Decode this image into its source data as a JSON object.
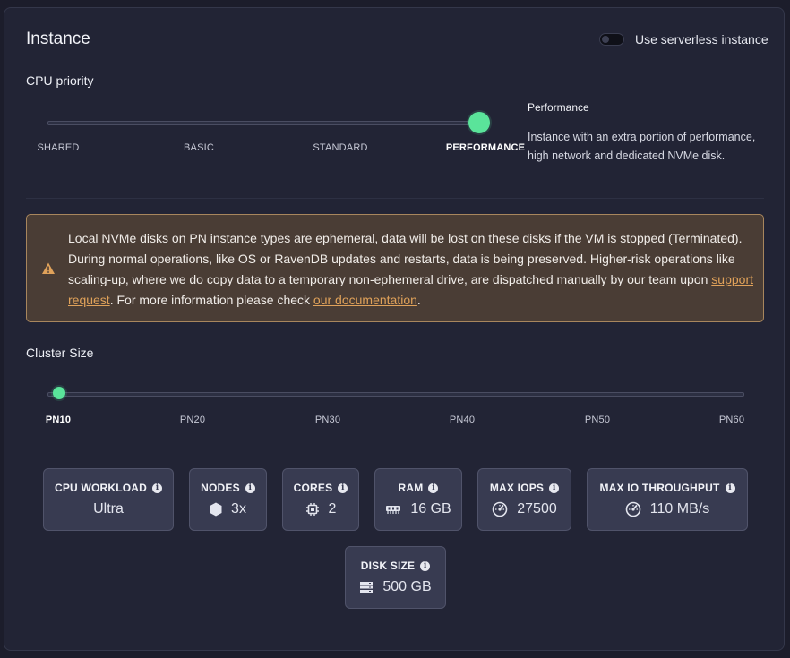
{
  "header": {
    "title": "Instance",
    "serverless_toggle": {
      "label": "Use serverless instance",
      "on": false
    }
  },
  "cpu_priority": {
    "label": "CPU priority",
    "options": [
      "SHARED",
      "BASIC",
      "STANDARD",
      "PERFORMANCE"
    ],
    "selected": "PERFORMANCE",
    "description_title": "Performance",
    "description": "Instance with an extra portion of performance, high network and dedicated NVMe disk."
  },
  "warning": {
    "text_1": "Local NVMe disks on PN instance types are ephemeral, data will be lost on these disks if the VM is stopped (Terminated). During normal operations, like OS or RavenDB updates and restarts, data is being preserved. Higher-risk operations like scaling-up, where we do copy data to a temporary non-ephemeral drive, are dispatched manually by our team upon ",
    "link_1": "support request",
    "text_2": ". For more information please check ",
    "link_2": "our documentation",
    "text_3": ".",
    "icon": "warning-triangle-icon",
    "accent": "#e0a25a"
  },
  "cluster_size": {
    "label": "Cluster Size",
    "options": [
      "PN10",
      "PN20",
      "PN30",
      "PN40",
      "PN50",
      "PN60"
    ],
    "selected": "PN10"
  },
  "specs": {
    "cpu_workload": {
      "label": "CPU WORKLOAD",
      "value": "Ultra"
    },
    "nodes": {
      "label": "NODES",
      "value": "3x",
      "icon": "cube-icon"
    },
    "cores": {
      "label": "CORES",
      "value": "2",
      "icon": "chip-icon"
    },
    "ram": {
      "label": "RAM",
      "value": "16 GB",
      "icon": "memory-icon"
    },
    "max_iops": {
      "label": "MAX IOPS",
      "value": "27500",
      "icon": "gauge-icon"
    },
    "max_io_throughput": {
      "label": "MAX IO THROUGHPUT",
      "value": "110 MB/s",
      "icon": "gauge-icon"
    },
    "disk_size": {
      "label": "DISK SIZE",
      "value": "500 GB",
      "icon": "storage-icon"
    }
  },
  "colors": {
    "accent": "#5ae49a",
    "background": "#222435",
    "card": "#383b51"
  }
}
